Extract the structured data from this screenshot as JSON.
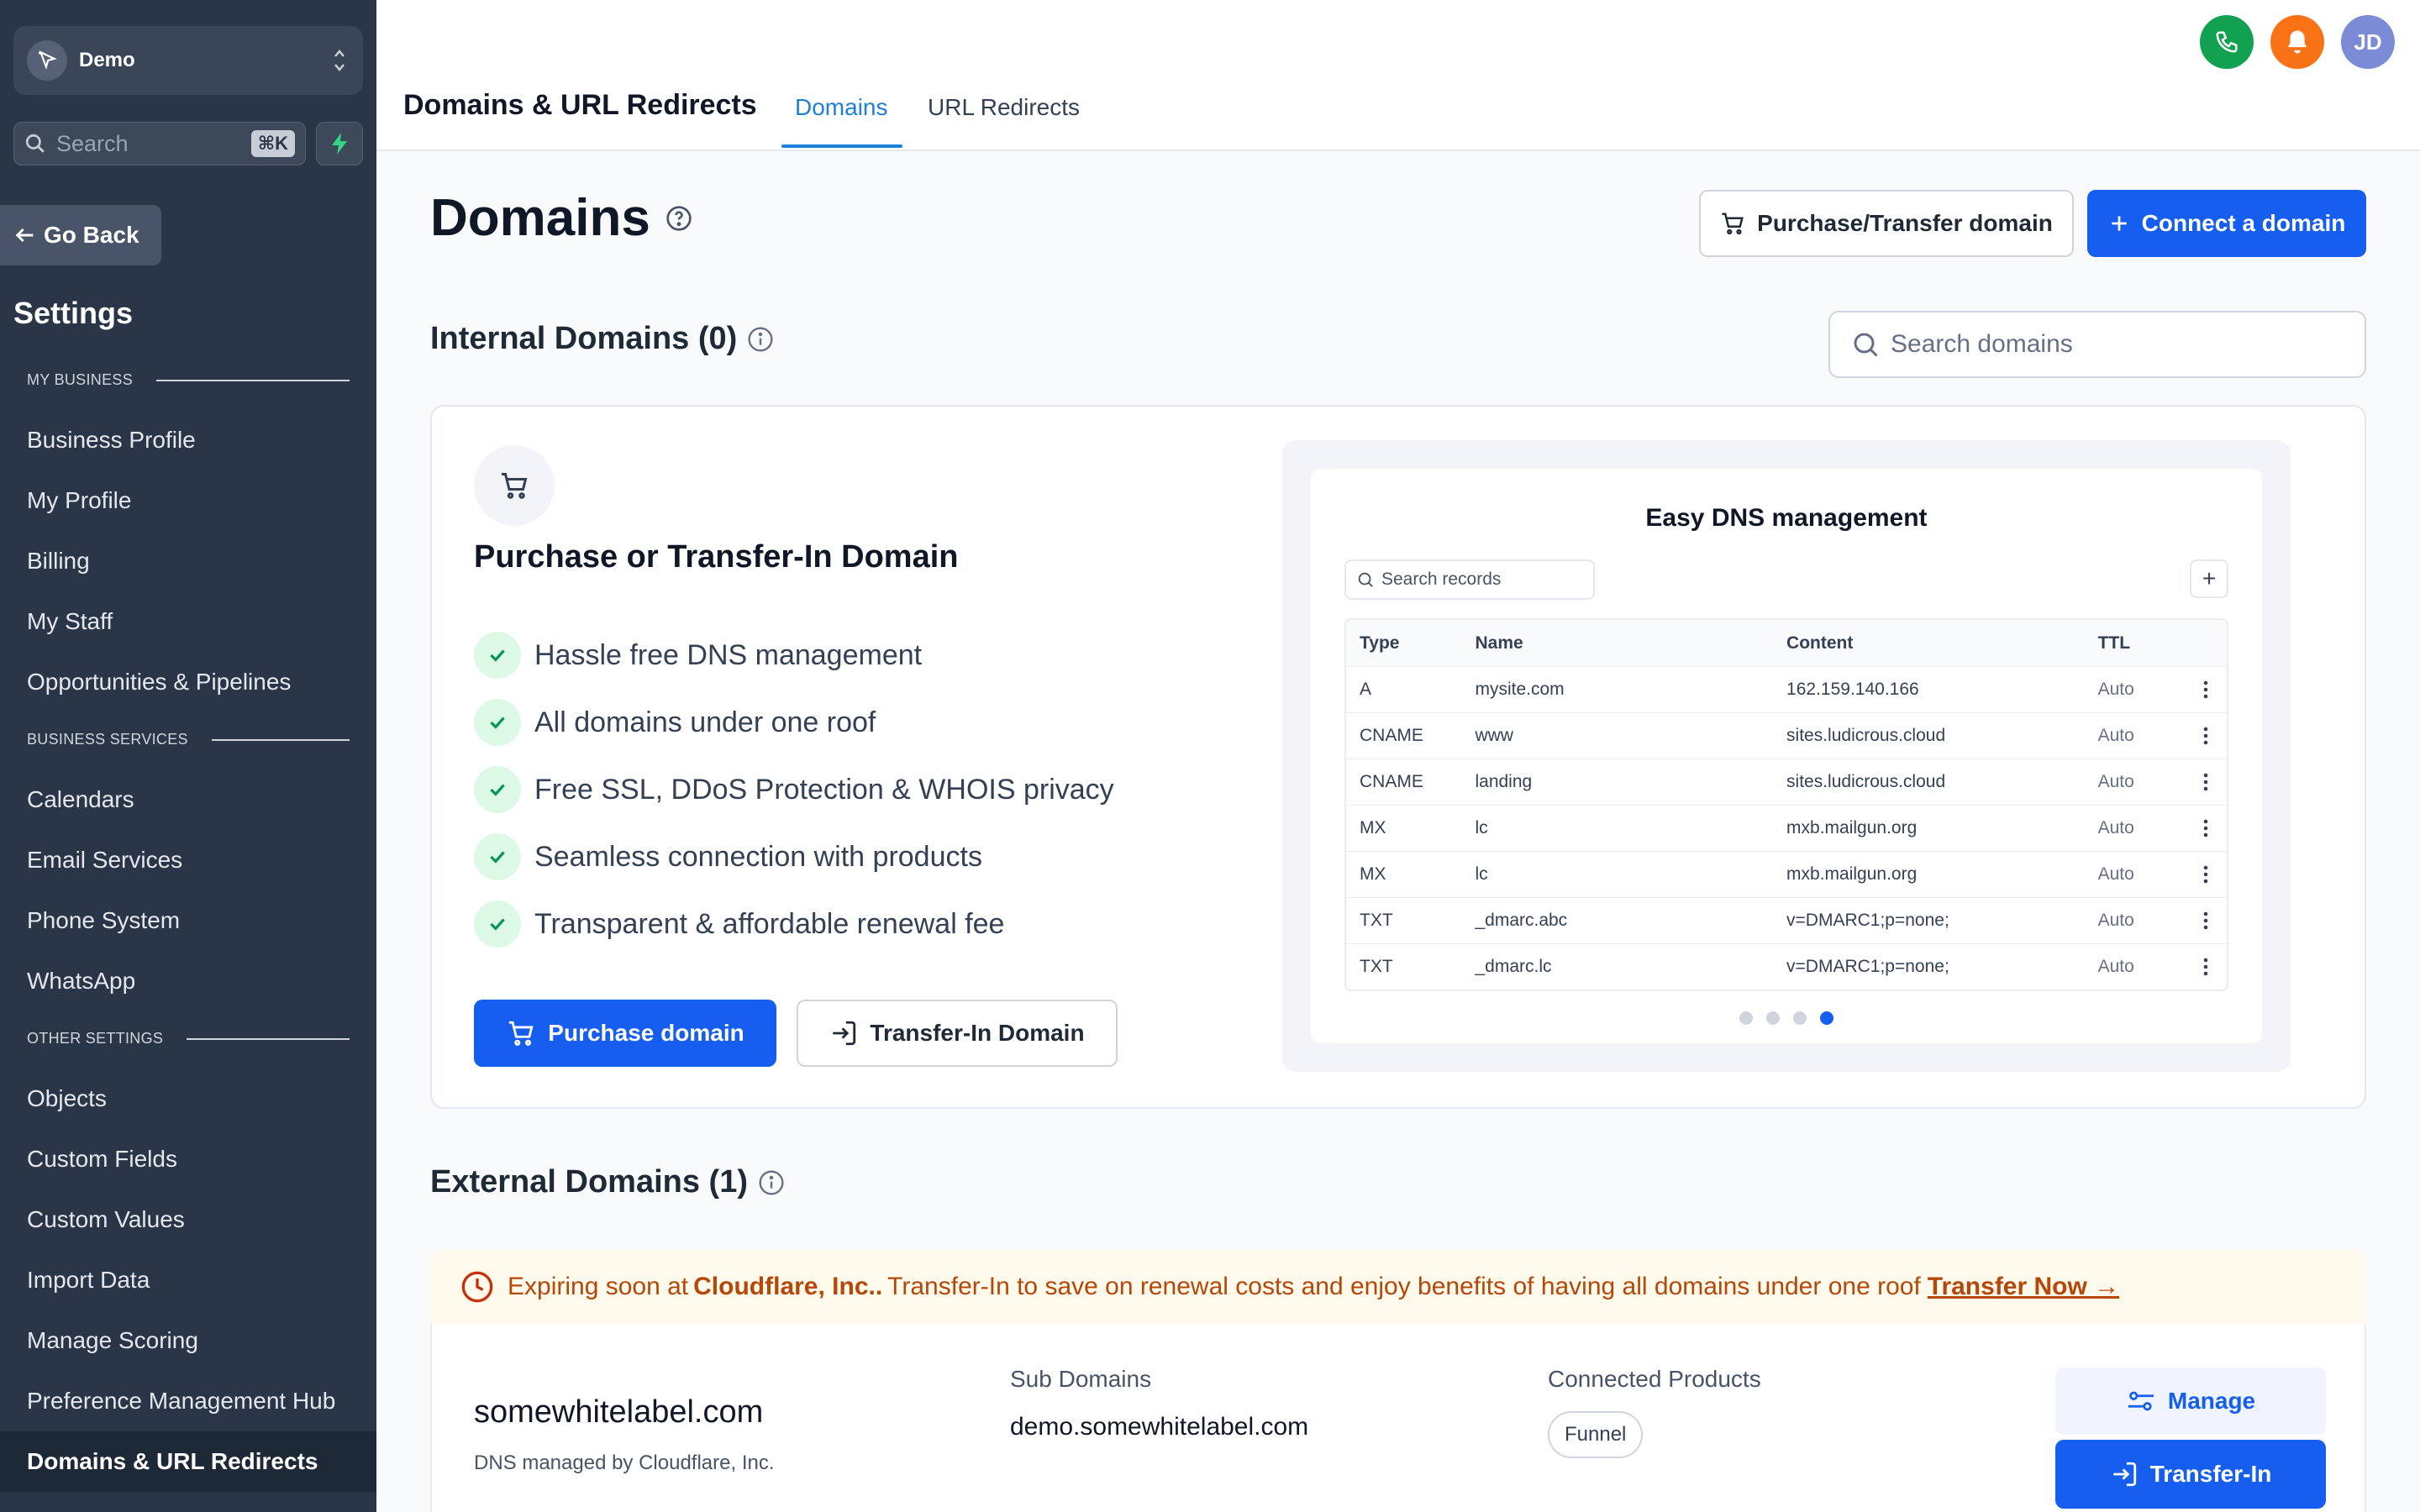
{
  "sidebar": {
    "location_name": "Demo",
    "search_placeholder": "Search",
    "search_shortcut": "⌘K",
    "go_back": "Go Back",
    "title": "Settings",
    "sections": {
      "my_business": "MY BUSINESS",
      "business_services": "BUSINESS SERVICES",
      "other_settings": "OTHER SETTINGS"
    },
    "my_business_items": [
      "Business Profile",
      "My Profile",
      "Billing",
      "My Staff",
      "Opportunities & Pipelines"
    ],
    "business_services_items": [
      "Calendars",
      "Email Services",
      "Phone System",
      "WhatsApp"
    ],
    "other_settings_items": [
      "Objects",
      "Custom Fields",
      "Custom Values",
      "Import Data",
      "Manage Scoring",
      "Preference Management Hub",
      "Domains & URL Redirects"
    ],
    "active_item": "Domains & URL Redirects"
  },
  "header": {
    "title": "Domains & URL Redirects",
    "tabs": [
      "Domains",
      "URL Redirects"
    ],
    "active_tab": "Domains",
    "avatar_initials": "JD",
    "colors": {
      "phone": "#12a150",
      "bell": "#f97316",
      "avatar": "#7c8bd6"
    }
  },
  "main": {
    "title": "Domains",
    "purchase_transfer_button": "Purchase/Transfer domain",
    "connect_button": "Connect a domain",
    "internal_title": "Internal Domains (0)",
    "search_placeholder": "Search domains"
  },
  "promo": {
    "heading": "Purchase or Transfer-In Domain",
    "features": [
      "Hassle free DNS management",
      "All domains under one roof",
      "Free SSL, DDoS Protection & WHOIS privacy",
      "Seamless connection with products",
      "Transparent & affordable renewal fee"
    ],
    "purchase_button": "Purchase domain",
    "transfer_button": "Transfer-In Domain"
  },
  "dns_preview": {
    "title": "Easy DNS management",
    "search_placeholder": "Search records",
    "columns": [
      "Type",
      "Name",
      "Content",
      "TTL"
    ],
    "rows": [
      [
        "A",
        "mysite.com",
        "162.159.140.166",
        "Auto"
      ],
      [
        "CNAME",
        "www",
        "sites.ludicrous.cloud",
        "Auto"
      ],
      [
        "CNAME",
        "landing",
        "sites.ludicrous.cloud",
        "Auto"
      ],
      [
        "MX",
        "lc",
        "mxb.mailgun.org",
        "Auto"
      ],
      [
        "MX",
        "lc",
        "mxb.mailgun.org",
        "Auto"
      ],
      [
        "TXT",
        "_dmarc.abc",
        "v=DMARC1;p=none;",
        "Auto"
      ],
      [
        "TXT",
        "_dmarc.lc",
        "v=DMARC1;p=none;",
        "Auto"
      ]
    ],
    "carousel_pages": 4,
    "carousel_active": 4
  },
  "external": {
    "title": "External Domains (1)",
    "banner": {
      "prefix": "Expiring soon at",
      "provider": "Cloudflare, Inc..",
      "message": "Transfer-In to save on renewal costs and enjoy benefits of having all domains under one roof",
      "link": "Transfer Now →"
    },
    "domain": "somewhitelabel.com",
    "managed_by": "DNS managed by Cloudflare, Inc.",
    "sub_domains_label": "Sub Domains",
    "sub_domain": "demo.somewhitelabel.com",
    "connected_label": "Connected Products",
    "connected_product": "Funnel",
    "manage_button": "Manage",
    "transfer_button": "Transfer-In"
  }
}
